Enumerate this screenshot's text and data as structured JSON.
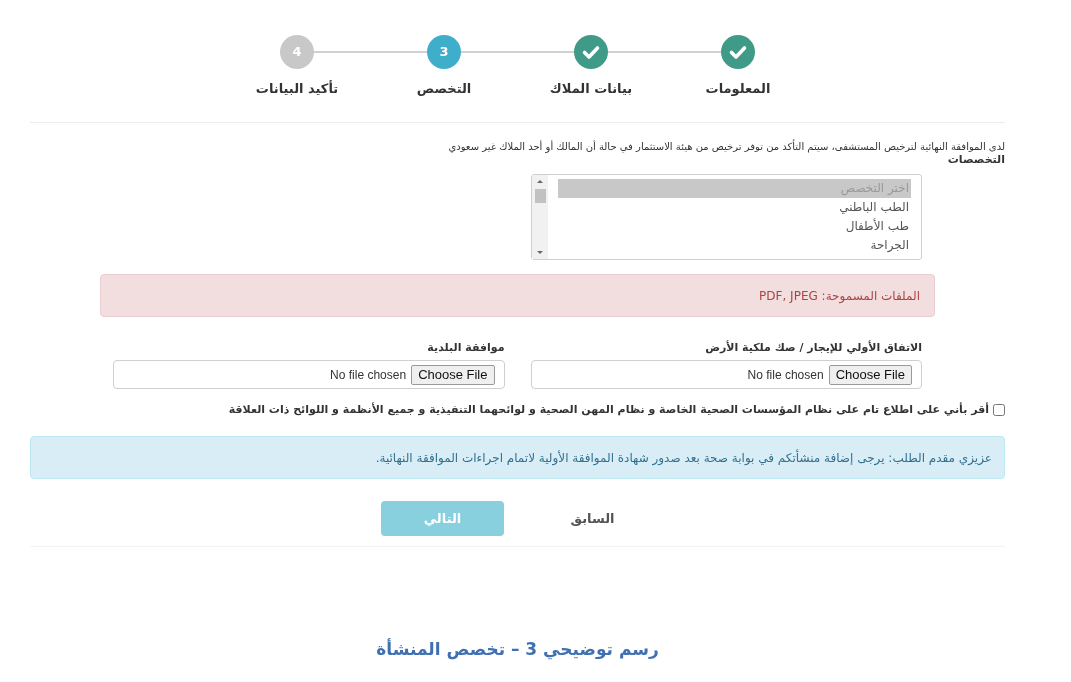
{
  "stepper": {
    "steps": [
      {
        "label": "المعلومات",
        "done": true,
        "selected": false
      },
      {
        "label": "بيانات الملاك",
        "done": true,
        "selected": false
      },
      {
        "label": "التخصص",
        "done": false,
        "selected": true,
        "number": "3"
      },
      {
        "label": "تأكيد البيانات",
        "done": false,
        "selected": false,
        "number": "4"
      }
    ]
  },
  "notice": "لدى الموافقة النهائية لترخيص المستشفى، سيتم التأكد من توفر ترخيص من هيئة الاستثمار في حالة أن المالك أو أحد الملاك غير سعودي",
  "specialties": {
    "label": "التخصصات",
    "options": [
      {
        "text": "اختر التخصص",
        "selected": true,
        "disabled": true
      },
      {
        "text": "الطب الباطني",
        "selected": false,
        "disabled": false
      },
      {
        "text": "طب الأطفال",
        "selected": false,
        "disabled": false
      },
      {
        "text": "الجراحة",
        "selected": false,
        "disabled": false
      }
    ]
  },
  "allowed_files_alert": "الملفات المسموحة: PDF, JPEG",
  "uploads": [
    {
      "label": "الاتفاق الأولي للإيجار / صك ملكية الأرض",
      "button": "Choose File",
      "status": "No file chosen"
    },
    {
      "label": "موافقة البلدية",
      "button": "Choose File",
      "status": "No file chosen"
    }
  ],
  "agreement": {
    "label": "أقر بأني على اطلاع تام على نظام المؤسسات الصحية الخاصة و نظام المهن الصحية و لوائحهما التنفيذية و جميع الأنظمة و اللوائح ذات العلاقة",
    "checked": false
  },
  "info_alert": "عزيزي مقدم الطلب: يرجى إضافة منشأتكم في بوابة صحة بعد صدور شهادة الموافقة الأولية لاتمام اجراءات الموافقة النهائية.",
  "buttons": [
    {
      "label": "السابق",
      "kind": "link",
      "disabled": false
    },
    {
      "label": "التالي",
      "kind": "primary",
      "disabled": true
    }
  ],
  "caption": "رسم توضيحي 3 – تخصص المنشأة"
}
